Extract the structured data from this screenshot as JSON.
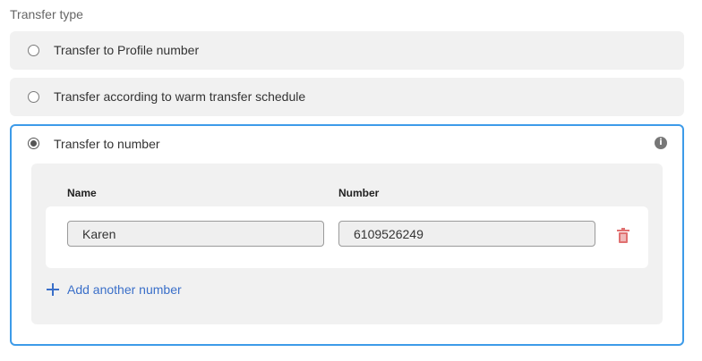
{
  "section_title": "Transfer type",
  "options": [
    {
      "label": "Transfer to Profile number",
      "selected": false
    },
    {
      "label": "Transfer according to warm transfer schedule",
      "selected": false
    },
    {
      "label": "Transfer to number",
      "selected": true
    }
  ],
  "info_icon": "info-icon",
  "table": {
    "headers": {
      "name": "Name",
      "number": "Number"
    },
    "rows": [
      {
        "name": "Karen",
        "number": "6109526249",
        "delete_icon": "trash-icon"
      }
    ]
  },
  "add_another_label": "Add another number",
  "colors": {
    "accent": "#3d9be9",
    "link": "#3a6fc9",
    "delete": "#e07070",
    "panel_bg": "#f1f1f1"
  }
}
